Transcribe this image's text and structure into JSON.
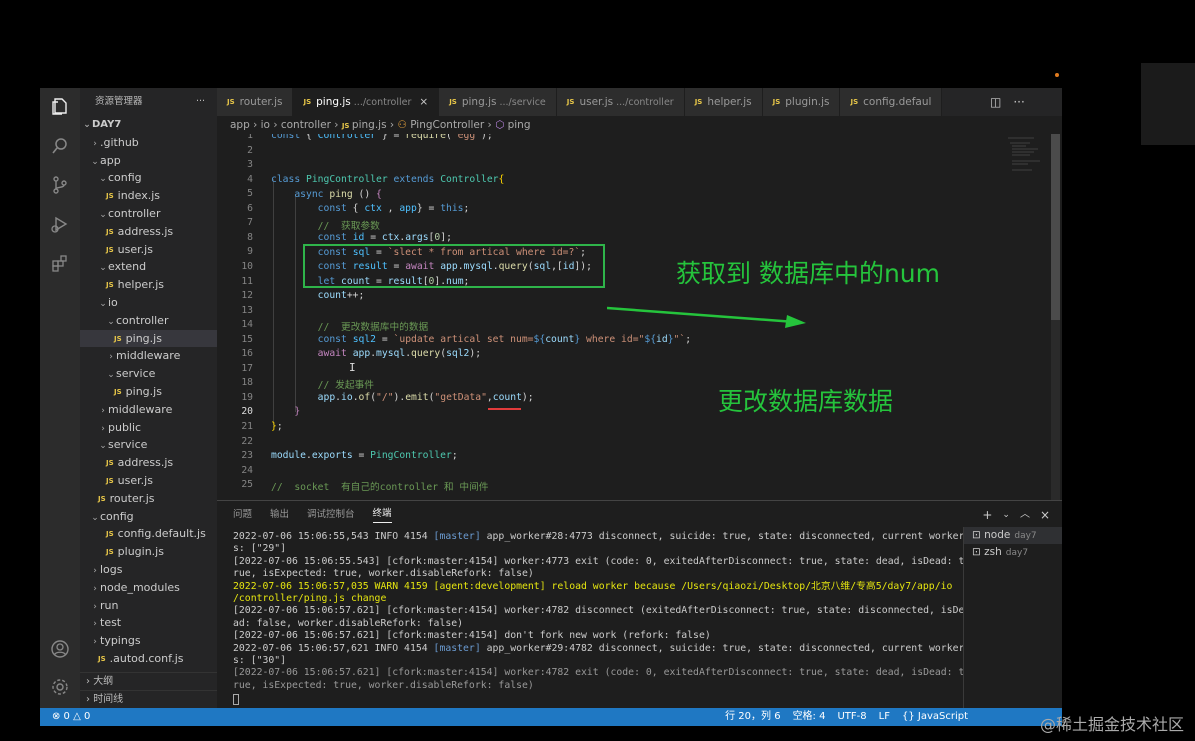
{
  "explorer": {
    "title": "资源管理器",
    "more": "···",
    "root": "DAY7",
    "items": [
      {
        "label": ".github",
        "indent": 1,
        "kind": "folder-closed"
      },
      {
        "label": "app",
        "indent": 1,
        "kind": "folder-open"
      },
      {
        "label": "config",
        "indent": 2,
        "kind": "folder-open"
      },
      {
        "label": "index.js",
        "indent": 3,
        "kind": "js"
      },
      {
        "label": "controller",
        "indent": 2,
        "kind": "folder-open"
      },
      {
        "label": "address.js",
        "indent": 3,
        "kind": "js"
      },
      {
        "label": "user.js",
        "indent": 3,
        "kind": "js"
      },
      {
        "label": "extend",
        "indent": 2,
        "kind": "folder-open"
      },
      {
        "label": "helper.js",
        "indent": 3,
        "kind": "js"
      },
      {
        "label": "io",
        "indent": 2,
        "kind": "folder-open"
      },
      {
        "label": "controller",
        "indent": 3,
        "kind": "folder-open"
      },
      {
        "label": "ping.js",
        "indent": 4,
        "kind": "js",
        "selected": true
      },
      {
        "label": "middleware",
        "indent": 3,
        "kind": "folder-closed"
      },
      {
        "label": "service",
        "indent": 3,
        "kind": "folder-open"
      },
      {
        "label": "ping.js",
        "indent": 4,
        "kind": "js"
      },
      {
        "label": "middleware",
        "indent": 2,
        "kind": "folder-closed"
      },
      {
        "label": "public",
        "indent": 2,
        "kind": "folder-closed"
      },
      {
        "label": "service",
        "indent": 2,
        "kind": "folder-open"
      },
      {
        "label": "address.js",
        "indent": 3,
        "kind": "js"
      },
      {
        "label": "user.js",
        "indent": 3,
        "kind": "js"
      },
      {
        "label": "router.js",
        "indent": 2,
        "kind": "js"
      },
      {
        "label": "config",
        "indent": 1,
        "kind": "folder-open"
      },
      {
        "label": "config.default.js",
        "indent": 3,
        "kind": "js"
      },
      {
        "label": "plugin.js",
        "indent": 3,
        "kind": "js"
      },
      {
        "label": "logs",
        "indent": 1,
        "kind": "folder-closed"
      },
      {
        "label": "node_modules",
        "indent": 1,
        "kind": "folder-closed"
      },
      {
        "label": "run",
        "indent": 1,
        "kind": "folder-closed"
      },
      {
        "label": "test",
        "indent": 1,
        "kind": "folder-closed"
      },
      {
        "label": "typings",
        "indent": 1,
        "kind": "folder-closed"
      },
      {
        "label": ".autod.conf.js",
        "indent": 2,
        "kind": "js"
      }
    ],
    "outline": "大纲",
    "timeline": "时间线"
  },
  "tabs": [
    {
      "label": "router.js",
      "sub": "",
      "active": false
    },
    {
      "label": "ping.js",
      "sub": ".../controller",
      "active": true
    },
    {
      "label": "ping.js",
      "sub": ".../service",
      "active": false
    },
    {
      "label": "user.js",
      "sub": ".../controller",
      "active": false
    },
    {
      "label": "helper.js",
      "sub": "",
      "active": false
    },
    {
      "label": "plugin.js",
      "sub": "",
      "active": false
    },
    {
      "label": "config.defaul",
      "sub": "",
      "active": false
    }
  ],
  "breadcrumb": [
    "app",
    "io",
    "controller",
    "ping.js",
    "PingController",
    "ping"
  ],
  "code_lines": [
    "1",
    "2",
    "3",
    "4",
    "5",
    "6",
    "7",
    "8",
    "9",
    "10",
    "11",
    "12",
    "13",
    "14",
    "15",
    "16",
    "17",
    "18",
    "19",
    "20",
    "21",
    "22",
    "23",
    "24",
    "25"
  ],
  "current_line": "20",
  "annotations": {
    "get_num": "获取到 数据库中的num",
    "update_db": "更改数据库数据"
  },
  "panel": {
    "tabs": [
      "问题",
      "输出",
      "调试控制台",
      "终端"
    ],
    "active_tab": "终端",
    "terminals": [
      {
        "name": "node",
        "dir": "day7",
        "active": true
      },
      {
        "name": "zsh",
        "dir": "day7",
        "active": false
      }
    ],
    "log": [
      "2022-07-06 15:06:55,543 INFO 4154 [master] app_worker#28:4773 disconnect, suicide: true, state: disconnected, current worker",
      "s: [\"29\"]",
      "[2022-07-06 15:06:55.543] [cfork:master:4154] worker:4773 exit (code: 0, exitedAfterDisconnect: true, state: dead, isDead: t",
      "rue, isExpected: true, worker.disableRefork: false)",
      "2022-07-06 15:06:57,035 WARN 4159 [agent:development] reload worker because /Users/qiaozi/Desktop/北京八维/专高5/day7/app/io",
      "/controller/ping.js change",
      "[2022-07-06 15:06:57.621] [cfork:master:4154] worker:4782 disconnect (exitedAfterDisconnect: true, state: disconnected, isDe",
      "ad: false, worker.disableRefork: false)",
      "[2022-07-06 15:06:57.621] [cfork:master:4154] don't fork new work (refork: false)",
      "2022-07-06 15:06:57,621 INFO 4154 [master] app_worker#29:4782 disconnect, suicide: true, state: disconnected, current worker",
      "s: [\"30\"]",
      "[2022-07-06 15:06:57.621] [cfork:master:4154] worker:4782 exit (code: 0, exitedAfterDisconnect: true, state: dead, isDead: t",
      "rue, isExpected: true, worker.disableRefork: false)"
    ]
  },
  "status": {
    "problems": "⊗ 0 △ 0",
    "position": "行 20，列 6",
    "spaces": "空格: 4",
    "encoding": "UTF-8",
    "eol": "LF",
    "language": "{} JavaScript"
  },
  "watermark": "@稀土掘金技术社区",
  "colors": {
    "statusbar": "#1f78c3",
    "annotation": "#25c43c",
    "editor_bg": "#1e1e1e",
    "sidebar_bg": "#252526"
  }
}
